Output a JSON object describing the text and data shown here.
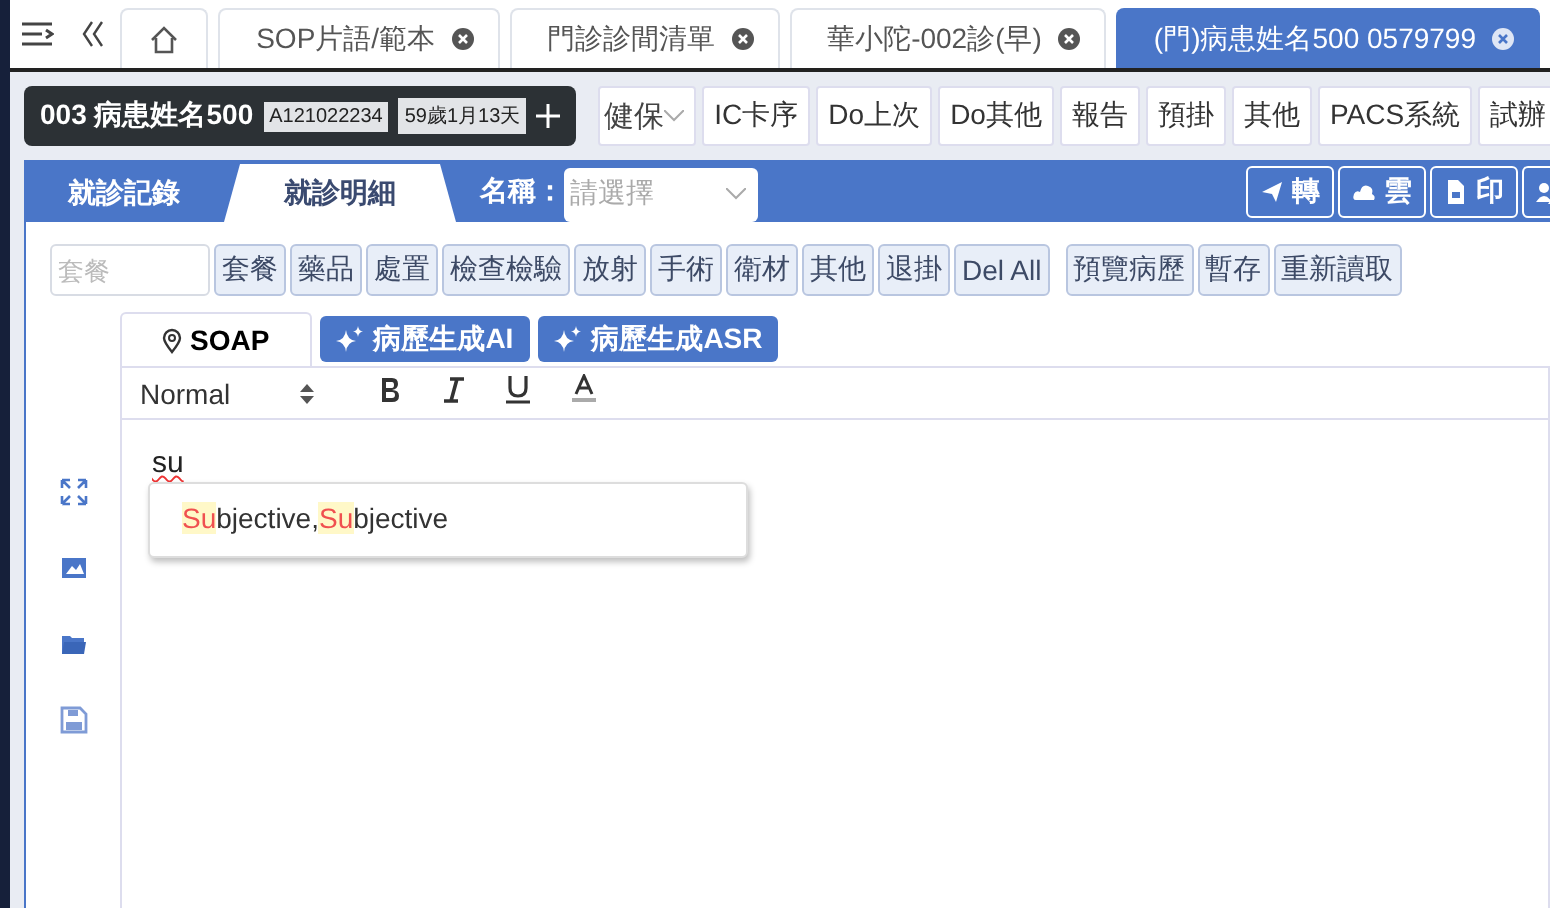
{
  "top_tabs": [
    {
      "kind": "home",
      "selected": false
    },
    {
      "label": "SOP片語/範本",
      "selected": false
    },
    {
      "label": "門診診間清單",
      "selected": false
    },
    {
      "label": "華小陀-002診(早)",
      "selected": false
    },
    {
      "label": "(門)病患姓名500 0579799",
      "selected": true
    }
  ],
  "patient": {
    "name": "003 病患姓名500",
    "id": "A121022234",
    "age": "59歲1月13天"
  },
  "insurance_select": {
    "value": "健保"
  },
  "toolbar_buttons": [
    "IC卡序",
    "Do上次",
    "Do其他",
    "報告",
    "預掛",
    "其他",
    "PACS系統",
    "試辦"
  ],
  "record_tabs": [
    {
      "label": "就診記錄",
      "selected": false
    },
    {
      "label": "就診明細",
      "selected": true
    }
  ],
  "name_filter": {
    "label": "名稱：",
    "placeholder": "請選擇"
  },
  "header_actions": [
    "轉",
    "雲",
    "印"
  ],
  "order_search": {
    "placeholder": "套餐"
  },
  "order_buttons": [
    "套餐",
    "藥品",
    "處置",
    "檢查檢驗",
    "放射",
    "手術",
    "衛材",
    "其他",
    "退掛",
    "Del All"
  ],
  "record_buttons": [
    "預覽病歷",
    "暫存",
    "重新讀取"
  ],
  "editor_tabs": [
    {
      "label": "SOAP",
      "kind": "tab",
      "selected": true
    },
    {
      "label": "病歷生成AI",
      "kind": "ai"
    },
    {
      "label": "病歷生成ASR",
      "kind": "ai"
    }
  ],
  "format_toolbar": {
    "style": "Normal"
  },
  "editor": {
    "text": "su",
    "misspelled": true
  },
  "suggestions": [
    {
      "parts": [
        {
          "text": "Su",
          "match": true
        },
        {
          "text": "bjective,",
          "match": false
        },
        {
          "text": "Su",
          "match": true
        },
        {
          "text": "bjective",
          "match": false
        }
      ]
    }
  ]
}
